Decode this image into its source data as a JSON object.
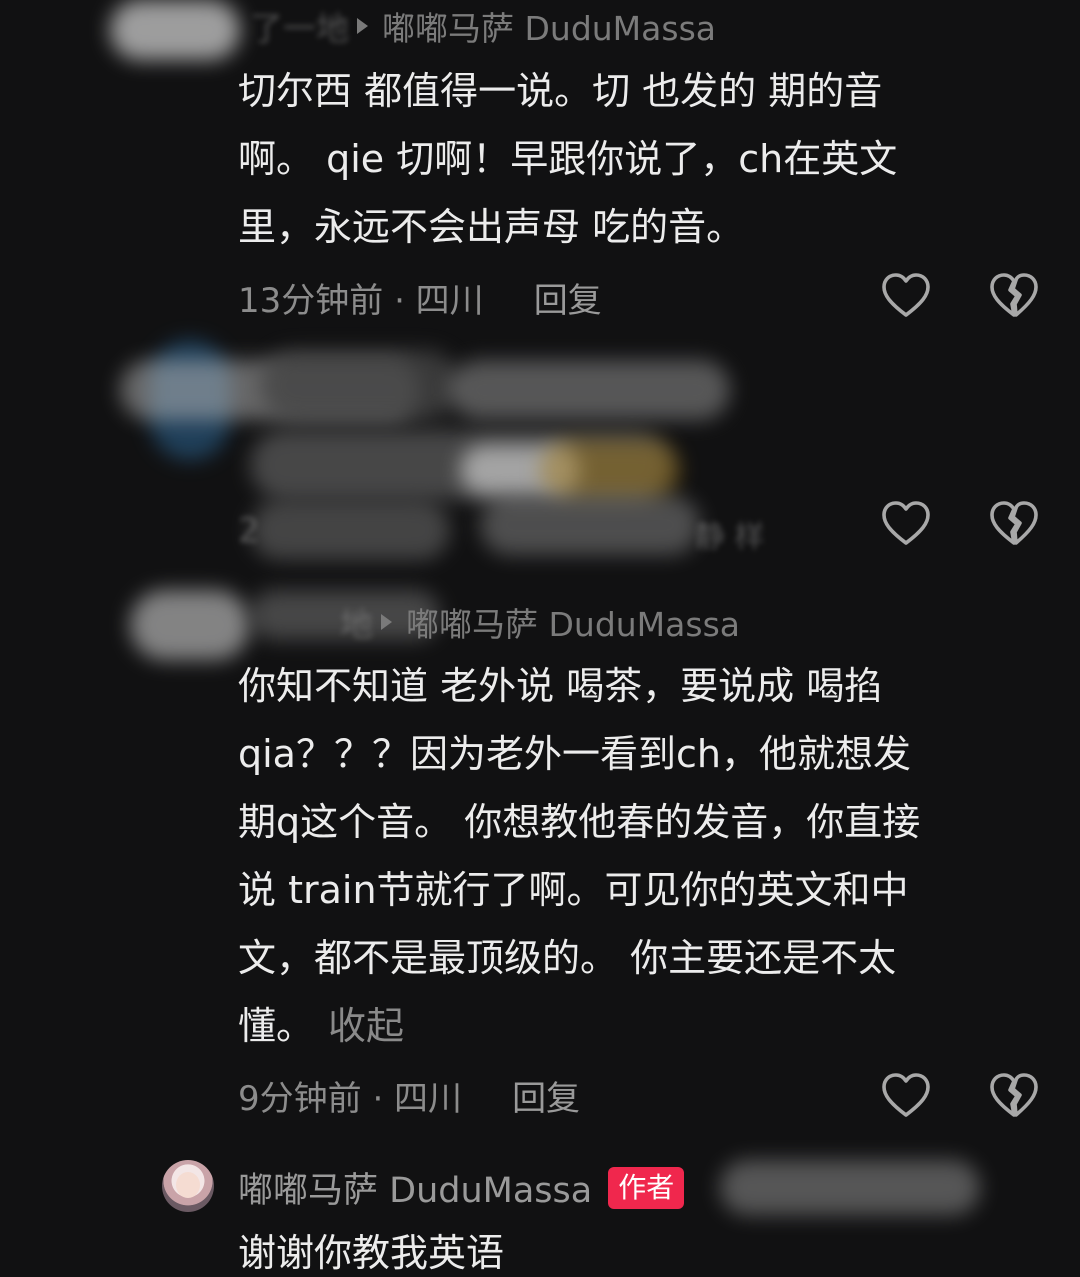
{
  "comment1": {
    "reply_head_prefix": "了一地",
    "reply_to": "嘟嘟马萨 DuduMassa",
    "lines": [
      "切尔西  都值得一说。切  也发的  期的音",
      "啊。 qie  切啊！早跟你说了，ch在英文",
      "里，永远不会出声母  吃的音。"
    ],
    "time": "13分钟前 · 四川",
    "reply_label": "回复"
  },
  "comment2": {
    "time_partial": "2",
    "trail_partial": "静 样"
  },
  "comment3": {
    "reply_head_prefix": "地",
    "reply_to": "嘟嘟马萨 DuduMassa",
    "lines": [
      "你知不知道  老外说  喝茶，要说成  喝掐",
      "qia？？？因为老外一看到ch，他就想发",
      "期q这个音。 你想教他春的发音，你直接",
      "说  train节就行了啊。可见你的英文和中",
      "文，都不是最顶级的。 你主要还是不太"
    ],
    "last_line": "懂。",
    "collapse_label": "收起",
    "time": "9分钟前 · 四川",
    "reply_label": "回复"
  },
  "author_reply": {
    "name": "嘟嘟马萨 DuduMassa",
    "badge": "作者",
    "text": "谢谢你教我英语"
  },
  "icons": {
    "like": "heart-outline-icon",
    "dislike": "broken-heart-icon"
  },
  "colors": {
    "background": "#111112",
    "author_badge": "#f0274d",
    "meta_text": "#8c8c8c"
  }
}
